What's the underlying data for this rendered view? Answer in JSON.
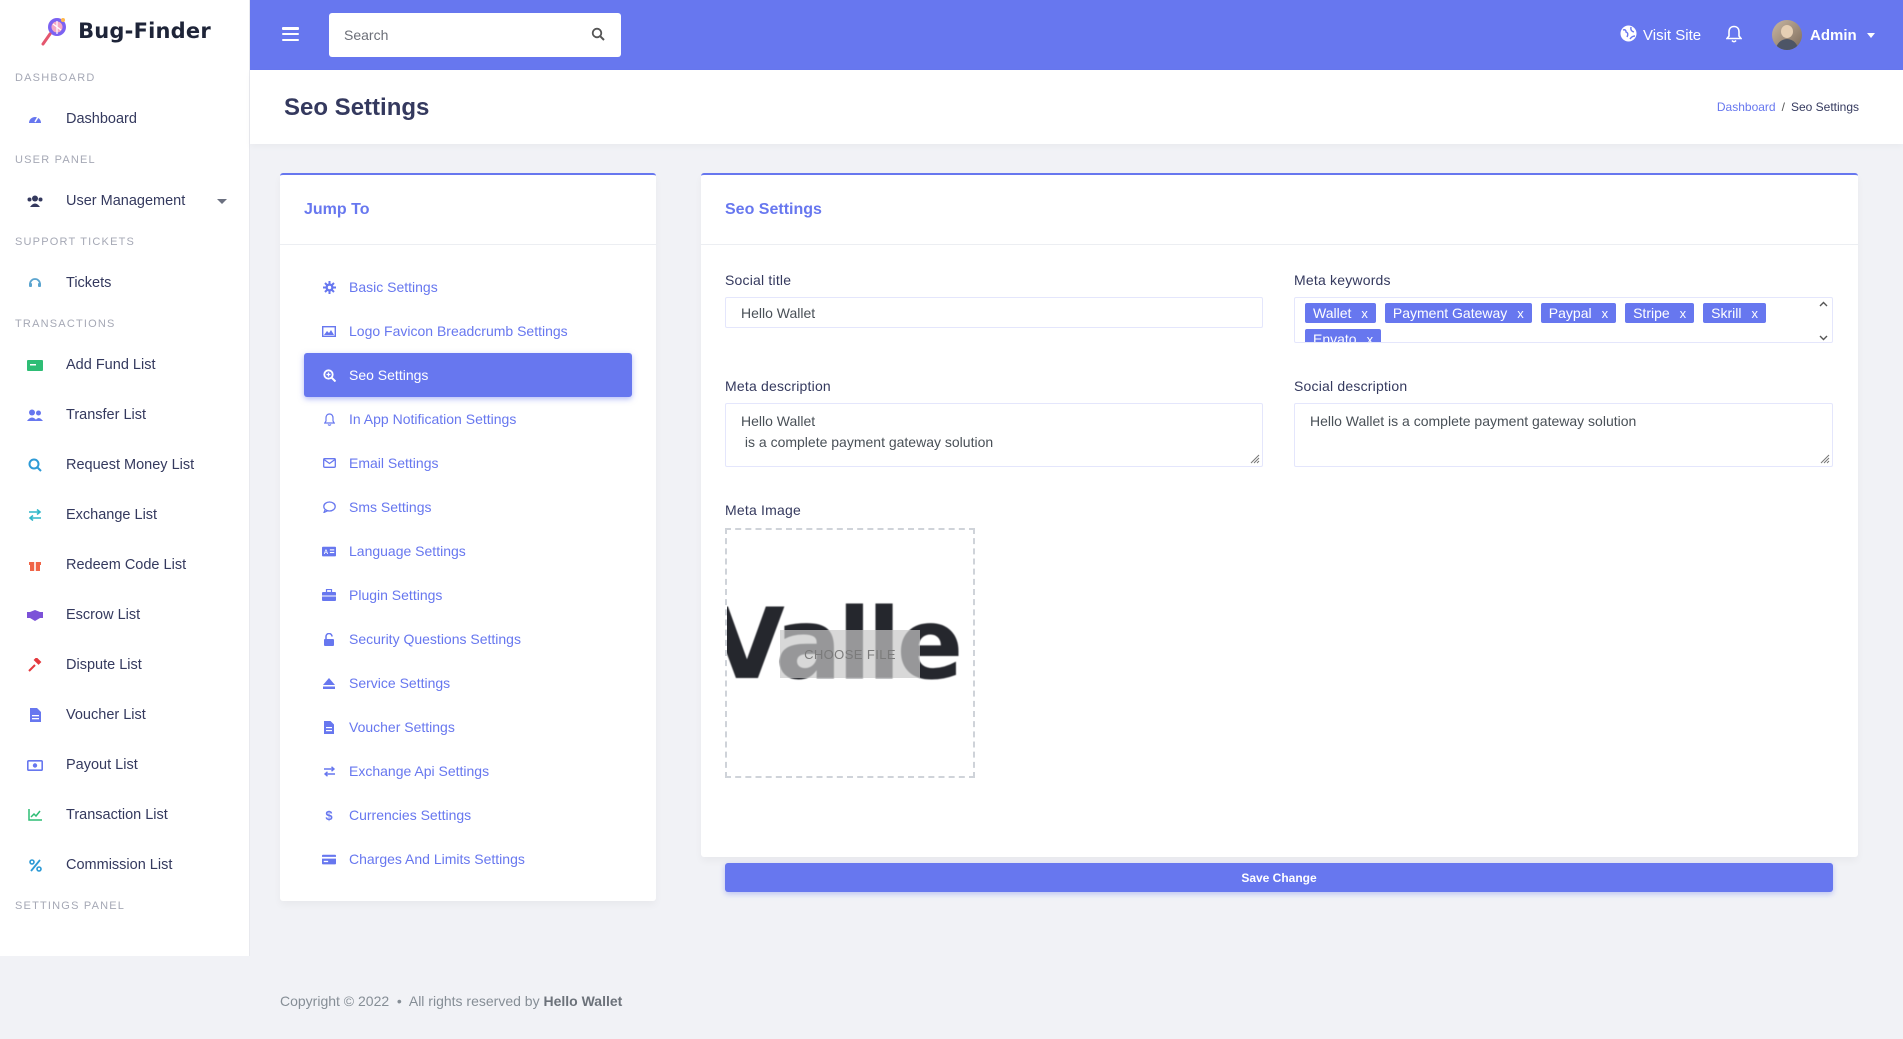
{
  "brand": {
    "name": "Bug-Finder"
  },
  "sidebar": {
    "sections": [
      {
        "heading": "DASHBOARD",
        "items": [
          {
            "label": "Dashboard",
            "icon": "dashboard-icon"
          }
        ]
      },
      {
        "heading": "USER PANEL",
        "items": [
          {
            "label": "User Management",
            "icon": "users-icon",
            "dropdown": true
          }
        ]
      },
      {
        "heading": "SUPPORT TICKETS",
        "items": [
          {
            "label": "Tickets",
            "icon": "headset-icon"
          }
        ]
      },
      {
        "heading": "TRANSACTIONS",
        "items": [
          {
            "label": "Add Fund List",
            "icon": "money-icon"
          },
          {
            "label": "Transfer List",
            "icon": "user-friends-icon"
          },
          {
            "label": "Request Money List",
            "icon": "search-dollar-icon"
          },
          {
            "label": "Exchange List",
            "icon": "exchange-icon"
          },
          {
            "label": "Redeem Code List",
            "icon": "gift-icon"
          },
          {
            "label": "Escrow List",
            "icon": "handshake-icon"
          },
          {
            "label": "Dispute List",
            "icon": "gavel-icon"
          },
          {
            "label": "Voucher List",
            "icon": "file-invoice-icon"
          },
          {
            "label": "Payout List",
            "icon": "money-bill-icon"
          },
          {
            "label": "Transaction List",
            "icon": "chart-line-icon"
          },
          {
            "label": "Commission List",
            "icon": "percent-icon"
          }
        ]
      },
      {
        "heading": "SETTINGS PANEL",
        "items": []
      }
    ]
  },
  "topbar": {
    "search_placeholder": "Search",
    "visit_site": "Visit Site",
    "admin_name": "Admin"
  },
  "page": {
    "title": "Seo Settings",
    "breadcrumb": {
      "home": "Dashboard",
      "current": "Seo Settings"
    }
  },
  "jump": {
    "title": "Jump To",
    "items": [
      {
        "label": "Basic Settings",
        "icon": "cog-icon"
      },
      {
        "label": "Logo Favicon Breadcrumb Settings",
        "icon": "image-icon"
      },
      {
        "label": "Seo Settings",
        "icon": "search-plus-icon",
        "active": true
      },
      {
        "label": "In App Notification Settings",
        "icon": "bell-icon"
      },
      {
        "label": "Email Settings",
        "icon": "envelope-icon"
      },
      {
        "label": "Sms Settings",
        "icon": "comment-icon"
      },
      {
        "label": "Language Settings",
        "icon": "language-icon"
      },
      {
        "label": "Plugin Settings",
        "icon": "toolbox-icon"
      },
      {
        "label": "Security Questions Settings",
        "icon": "lock-open-icon"
      },
      {
        "label": "Service Settings",
        "icon": "eject-icon"
      },
      {
        "label": "Voucher Settings",
        "icon": "file-icon"
      },
      {
        "label": "Exchange Api Settings",
        "icon": "exchange-icon"
      },
      {
        "label": "Currencies Settings",
        "icon": "dollar-icon"
      },
      {
        "label": "Charges And Limits Settings",
        "icon": "credit-card-icon"
      }
    ]
  },
  "seo": {
    "title": "Seo Settings",
    "social_title_label": "Social title",
    "social_title_value": "Hello Wallet",
    "meta_keywords_label": "Meta keywords",
    "meta_keywords": [
      "Wallet",
      "Payment Gateway",
      "Paypal",
      "Stripe",
      "Skrill",
      "Envato"
    ],
    "meta_description_label": "Meta description",
    "meta_description_line1": "Hello Wallet",
    "meta_description_line2": " is a complete payment gateway solution",
    "social_description_label": "Social description",
    "social_description_value": "Hello Wallet is a complete payment gateway solution",
    "meta_image_label": "Meta Image",
    "meta_image_text": "Valle",
    "choose_file": "CHOOSE FILE",
    "save_button": "Save Change"
  },
  "footer": {
    "copyright": "Copyright © 2022",
    "rights": "All rights reserved by",
    "site": "Hello Wallet"
  },
  "colors": {
    "primary": "#6777ef",
    "sidebar_text": "#34395e"
  }
}
